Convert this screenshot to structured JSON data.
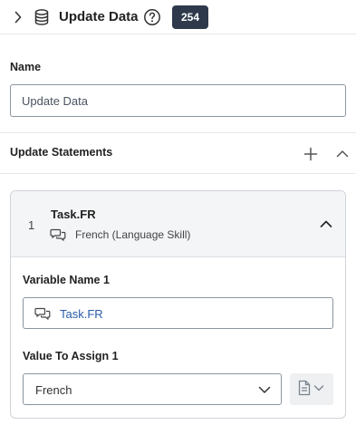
{
  "header": {
    "title": "Update Data",
    "badge": "254",
    "icons": [
      "chevron-right-icon",
      "database-icon",
      "help-circle-icon"
    ]
  },
  "name_field": {
    "label": "Name",
    "value": "Update Data"
  },
  "update_statements": {
    "label": "Update Statements",
    "icons": [
      "plus-icon",
      "chevron-up-icon"
    ],
    "items": [
      {
        "number": "1",
        "title": "Task.FR",
        "subtitle": "French (Language Skill)",
        "variable_label": "Variable Name 1",
        "variable_value": "Task.FR",
        "value_label": "Value To Assign 1",
        "value_selected": "French"
      }
    ]
  },
  "colors": {
    "badge_bg": "#2e3a4b",
    "link_blue": "#2a5ca8",
    "border": "#8b95a1",
    "card_header_bg": "#f4f5f7"
  }
}
